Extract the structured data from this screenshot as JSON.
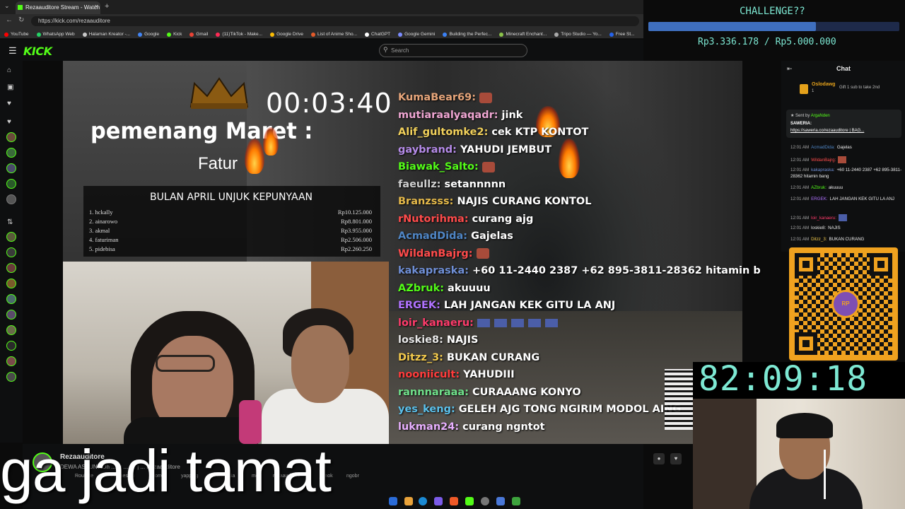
{
  "browser": {
    "tab_title": "Rezaauditore Stream - Watch",
    "url": "https://kick.com/rezaauditore",
    "bookmarks": [
      {
        "label": "YouTube",
        "color": "#ff0000"
      },
      {
        "label": "WhatsApp Web",
        "color": "#25d366"
      },
      {
        "label": "Halaman Kreator -...",
        "color": "#c9c9c9"
      },
      {
        "label": "Google",
        "color": "#4285f4"
      },
      {
        "label": "Kick",
        "color": "#53fc18"
      },
      {
        "label": "Gmail",
        "color": "#ea4335"
      },
      {
        "label": "(11)TikTok - Make...",
        "color": "#ff2a55"
      },
      {
        "label": "Google Drive",
        "color": "#fbbc04"
      },
      {
        "label": "List of Anime Sho...",
        "color": "#e35a2a"
      },
      {
        "label": "ChatGPT",
        "color": "#ffffff"
      },
      {
        "label": "Google Gemini",
        "color": "#7b8cff"
      },
      {
        "label": "Building the Perfec...",
        "color": "#3b82f6"
      },
      {
        "label": "Minecraft Enchant...",
        "color": "#8bc34a"
      },
      {
        "label": "Tripo Studio — Yo...",
        "color": "#aaaaaa"
      },
      {
        "label": "Free St...",
        "color": "#2563eb"
      }
    ]
  },
  "challenge": {
    "title": "CHALLENGE??",
    "amount": "Rp3.336.178 / Rp5.000.000",
    "progress": 0.667
  },
  "kick": {
    "logo": "KICK",
    "search_placeholder": "Search"
  },
  "overlay": {
    "timer": "00:03:40",
    "winner_title": "pemenang Maret  :",
    "winner_name": "Fatur",
    "leaderboard_title": "BULAN APRIL UNJUK KEPUNYAAN",
    "leaderboard": [
      {
        "rank": "1.",
        "name": "hckally",
        "amount": "Rp10.125.000"
      },
      {
        "rank": "2.",
        "name": "ainarowo",
        "amount": "Rp8.801.000"
      },
      {
        "rank": "3.",
        "name": "akmal",
        "amount": "Rp3.955.000"
      },
      {
        "rank": "4.",
        "name": "faturiman",
        "amount": "Rp2.506.000"
      },
      {
        "rank": "5.",
        "name": "pidebisa",
        "amount": "Rp2.260.250"
      }
    ]
  },
  "stream_chat": [
    {
      "user": "KumaBear69:",
      "msg": "",
      "color": "#e6a57a"
    },
    {
      "user": "mutiaraalyaqadr:",
      "msg": "jink",
      "color": "#f0a6d3"
    },
    {
      "user": "Alif_gultomke2:",
      "msg": "cek KTP KONTOT",
      "color": "#f2d15b"
    },
    {
      "user": "gaybrand:",
      "msg": "YAHUDI JEMBUT",
      "color": "#b58be8"
    },
    {
      "user": "Biawak_Salto:",
      "msg": "",
      "color": "#53fc18"
    },
    {
      "user": "faeullz:",
      "msg": "setannnnn",
      "color": "#cfcfcf"
    },
    {
      "user": "Branzsss:",
      "msg": "NAJIS CURANG KONTOL",
      "color": "#e5b94a"
    },
    {
      "user": "rNutorihma:",
      "msg": "curang ajg",
      "color": "#ff4b4b"
    },
    {
      "user": "AcmadDida:",
      "msg": "Gajelas",
      "color": "#4f86c6"
    },
    {
      "user": "WildanBajrg:",
      "msg": "",
      "color": "#ff4b4b"
    },
    {
      "user": "kakapraska:",
      "msg": "+60 11-2440 2387 +62 895-3811-28362 hitamin b",
      "color": "#6f8fd6"
    },
    {
      "user": "AZbruk:",
      "msg": "akuuuu",
      "color": "#53fc18"
    },
    {
      "user": "ERGEK:",
      "msg": "LAH JANGAN KEK GITU LA ANJ",
      "color": "#b072ff"
    },
    {
      "user": "loir_kanaeru:",
      "msg": "",
      "color": "#ff3b6b"
    },
    {
      "user": "loskie8:",
      "msg": "NAJIS",
      "color": "#e8e8e8"
    },
    {
      "user": "Ditzz_3:",
      "msg": "BUKAN CURANG",
      "color": "#f2c94c"
    },
    {
      "user": "nooniicult:",
      "msg": "YAHUDIII",
      "color": "#ff3b3b"
    },
    {
      "user": "rannnaraaa:",
      "msg": "CURAAANG KONYO",
      "color": "#6fe08a"
    },
    {
      "user": "yes_keng:",
      "msg": "GELEH AJG TONG NGIRIM MODOL AING",
      "color": "#5bc0eb"
    },
    {
      "user": "lukman24:",
      "msg": "curang ngntot",
      "color": "#e8b0ff"
    }
  ],
  "channel": {
    "name": "Rezaauditore",
    "title": "DEWA ASBUN? Oh ... tv ... ct! | ... Rezaauditore",
    "tags": [
      "Roulette",
      "Indonesian",
      "Horror",
      "yapping",
      "Indonesia",
      "mex",
      "rezaauditore",
      "jomok",
      "ngobr"
    ]
  },
  "caption": "ga jadi tamat",
  "kick_chat": {
    "header": "Chat",
    "gifter_name": "Oslodawg",
    "gifter_sub": "1",
    "gifter_text": "Gift 1 sub to take 2nd",
    "pinned_by": "Sent by",
    "pinned_user": "ArgaNden",
    "pinned_label": "SAWERIA:",
    "pinned_link": "https://saweria.co/rezaauditore | BAG...",
    "messages": [
      {
        "time": "12:01 AM",
        "user": "AcmadDida:",
        "msg": "Gajelas",
        "color": "#4f86c6"
      },
      {
        "time": "12:01 AM",
        "user": "WildanBajrg:",
        "msg": "",
        "color": "#ff4b4b"
      },
      {
        "time": "12:01 AM",
        "user": "kakapraska:",
        "msg": "+60 11-2440 2387 +62 895-3811-28362 hitamin bang",
        "color": "#6f8fd6"
      },
      {
        "time": "12:01 AM",
        "user": "AZbruk:",
        "msg": "akuuuu",
        "color": "#53fc18"
      },
      {
        "time": "12:01 AM",
        "user": "ERGEK:",
        "msg": "LAH JANGAN KEK GITU LA ANJ",
        "color": "#b072ff"
      },
      {
        "time": "12:01 AM",
        "user": "loir_kanaeru:",
        "msg": "",
        "color": "#ff3b6b"
      },
      {
        "time": "12:01 AM",
        "user": "loskie8:",
        "msg": "NAJIS",
        "color": "#e8e8e8"
      },
      {
        "time": "12:01 AM",
        "user": "Ditzz_3:",
        "msg": "BUKAN CURANG",
        "color": "#f2c94c"
      }
    ]
  },
  "big_timer": "82:09:18",
  "colors": {
    "kick_green": "#53fc18",
    "overlay_cyan": "#7de8d3",
    "progress_blue": "#3f6fbf",
    "qr_orange": "#f0a21f"
  }
}
